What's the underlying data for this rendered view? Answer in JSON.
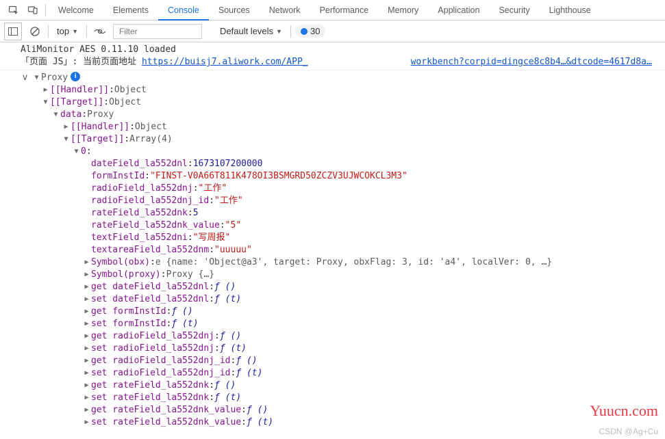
{
  "tabs": {
    "welcome": "Welcome",
    "elements": "Elements",
    "console": "Console",
    "sources": "Sources",
    "network": "Network",
    "performance": "Performance",
    "memory": "Memory",
    "application": "Application",
    "security": "Security",
    "lighthouse": "Lighthouse"
  },
  "toolbar": {
    "context": "top",
    "filter_placeholder": "Filter",
    "levels": "Default levels",
    "issues_count": "30"
  },
  "log": {
    "line1": "AliMonitor AES 0.11.10 loaded",
    "line2_prefix": "「页面 JS」: 当前页面地址 ",
    "line2_url_a": "https://buisj7.aliwork.com/APP_",
    "line2_url_b": "workbench?corpid=dingce8c8b4…&dtcode=4617d8a…"
  },
  "tree": {
    "root_marker": "v",
    "proxy": "Proxy",
    "handler": "[[Handler]]",
    "target": "[[Target]]",
    "object": "Object",
    "data": "data",
    "proxy_val": "Proxy",
    "array4": "Array(4)",
    "idx0": "0",
    "props": {
      "dateField_la552dnl": {
        "k": "dateField_la552dnl",
        "v": "1673107200000",
        "t": "num"
      },
      "formInstId": {
        "k": "formInstId",
        "v": "\"FINST-V0A66T811K478OI3BSMGRD50ZCZV3UJWCOKCL3M3\"",
        "t": "str"
      },
      "radioField_la552dnj": {
        "k": "radioField_la552dnj",
        "v": "\"工作\"",
        "t": "str"
      },
      "radioField_la552dnj_id": {
        "k": "radioField_la552dnj_id",
        "v": "\"工作\"",
        "t": "str"
      },
      "rateField_la552dnk": {
        "k": "rateField_la552dnk",
        "v": "5",
        "t": "num"
      },
      "rateField_la552dnk_value": {
        "k": "rateField_la552dnk_value",
        "v": "\"5\"",
        "t": "str"
      },
      "textField_la552dni": {
        "k": "textField_la552dni",
        "v": "\"写周报\"",
        "t": "str"
      },
      "textareaField_la552dnm": {
        "k": "textareaField_la552dnm",
        "v": "\"uuuuu\"",
        "t": "str"
      }
    },
    "symbol_obx": {
      "k": "Symbol(obx)",
      "v": "e {name: 'Object@a3', target: Proxy, obxFlag: 3, id: 'a4', localVer: 0, …}"
    },
    "symbol_proxy": {
      "k": "Symbol(proxy)",
      "v": "Proxy {…}"
    },
    "accessors": [
      {
        "k": "get dateField_la552dnl",
        "a": "()"
      },
      {
        "k": "set dateField_la552dnl",
        "a": "(t)"
      },
      {
        "k": "get formInstId",
        "a": "()"
      },
      {
        "k": "set formInstId",
        "a": "(t)"
      },
      {
        "k": "get radioField_la552dnj",
        "a": "()"
      },
      {
        "k": "set radioField_la552dnj",
        "a": "(t)"
      },
      {
        "k": "get radioField_la552dnj_id",
        "a": "()"
      },
      {
        "k": "set radioField_la552dnj_id",
        "a": "(t)"
      },
      {
        "k": "get rateField_la552dnk",
        "a": "()"
      },
      {
        "k": "set rateField_la552dnk",
        "a": "(t)"
      },
      {
        "k": "get rateField_la552dnk_value",
        "a": "()"
      },
      {
        "k": "set rateField_la552dnk_value",
        "a": "(t)"
      }
    ]
  },
  "watermark1": "Yuucn.com",
  "watermark2": "CSDN @Ag+Cu"
}
